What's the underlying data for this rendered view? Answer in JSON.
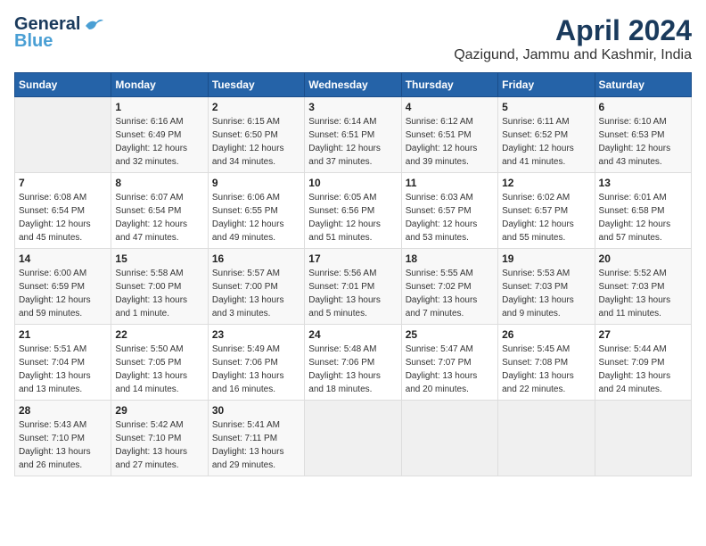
{
  "header": {
    "logo_line1": "General",
    "logo_line2": "Blue",
    "month_title": "April 2024",
    "location": "Qazigund, Jammu and Kashmir, India"
  },
  "days_of_week": [
    "Sunday",
    "Monday",
    "Tuesday",
    "Wednesday",
    "Thursday",
    "Friday",
    "Saturday"
  ],
  "weeks": [
    [
      {
        "day": "",
        "sunrise": "",
        "sunset": "",
        "daylight": ""
      },
      {
        "day": "1",
        "sunrise": "Sunrise: 6:16 AM",
        "sunset": "Sunset: 6:49 PM",
        "daylight": "Daylight: 12 hours and 32 minutes."
      },
      {
        "day": "2",
        "sunrise": "Sunrise: 6:15 AM",
        "sunset": "Sunset: 6:50 PM",
        "daylight": "Daylight: 12 hours and 34 minutes."
      },
      {
        "day": "3",
        "sunrise": "Sunrise: 6:14 AM",
        "sunset": "Sunset: 6:51 PM",
        "daylight": "Daylight: 12 hours and 37 minutes."
      },
      {
        "day": "4",
        "sunrise": "Sunrise: 6:12 AM",
        "sunset": "Sunset: 6:51 PM",
        "daylight": "Daylight: 12 hours and 39 minutes."
      },
      {
        "day": "5",
        "sunrise": "Sunrise: 6:11 AM",
        "sunset": "Sunset: 6:52 PM",
        "daylight": "Daylight: 12 hours and 41 minutes."
      },
      {
        "day": "6",
        "sunrise": "Sunrise: 6:10 AM",
        "sunset": "Sunset: 6:53 PM",
        "daylight": "Daylight: 12 hours and 43 minutes."
      }
    ],
    [
      {
        "day": "7",
        "sunrise": "Sunrise: 6:08 AM",
        "sunset": "Sunset: 6:54 PM",
        "daylight": "Daylight: 12 hours and 45 minutes."
      },
      {
        "day": "8",
        "sunrise": "Sunrise: 6:07 AM",
        "sunset": "Sunset: 6:54 PM",
        "daylight": "Daylight: 12 hours and 47 minutes."
      },
      {
        "day": "9",
        "sunrise": "Sunrise: 6:06 AM",
        "sunset": "Sunset: 6:55 PM",
        "daylight": "Daylight: 12 hours and 49 minutes."
      },
      {
        "day": "10",
        "sunrise": "Sunrise: 6:05 AM",
        "sunset": "Sunset: 6:56 PM",
        "daylight": "Daylight: 12 hours and 51 minutes."
      },
      {
        "day": "11",
        "sunrise": "Sunrise: 6:03 AM",
        "sunset": "Sunset: 6:57 PM",
        "daylight": "Daylight: 12 hours and 53 minutes."
      },
      {
        "day": "12",
        "sunrise": "Sunrise: 6:02 AM",
        "sunset": "Sunset: 6:57 PM",
        "daylight": "Daylight: 12 hours and 55 minutes."
      },
      {
        "day": "13",
        "sunrise": "Sunrise: 6:01 AM",
        "sunset": "Sunset: 6:58 PM",
        "daylight": "Daylight: 12 hours and 57 minutes."
      }
    ],
    [
      {
        "day": "14",
        "sunrise": "Sunrise: 6:00 AM",
        "sunset": "Sunset: 6:59 PM",
        "daylight": "Daylight: 12 hours and 59 minutes."
      },
      {
        "day": "15",
        "sunrise": "Sunrise: 5:58 AM",
        "sunset": "Sunset: 7:00 PM",
        "daylight": "Daylight: 13 hours and 1 minute."
      },
      {
        "day": "16",
        "sunrise": "Sunrise: 5:57 AM",
        "sunset": "Sunset: 7:00 PM",
        "daylight": "Daylight: 13 hours and 3 minutes."
      },
      {
        "day": "17",
        "sunrise": "Sunrise: 5:56 AM",
        "sunset": "Sunset: 7:01 PM",
        "daylight": "Daylight: 13 hours and 5 minutes."
      },
      {
        "day": "18",
        "sunrise": "Sunrise: 5:55 AM",
        "sunset": "Sunset: 7:02 PM",
        "daylight": "Daylight: 13 hours and 7 minutes."
      },
      {
        "day": "19",
        "sunrise": "Sunrise: 5:53 AM",
        "sunset": "Sunset: 7:03 PM",
        "daylight": "Daylight: 13 hours and 9 minutes."
      },
      {
        "day": "20",
        "sunrise": "Sunrise: 5:52 AM",
        "sunset": "Sunset: 7:03 PM",
        "daylight": "Daylight: 13 hours and 11 minutes."
      }
    ],
    [
      {
        "day": "21",
        "sunrise": "Sunrise: 5:51 AM",
        "sunset": "Sunset: 7:04 PM",
        "daylight": "Daylight: 13 hours and 13 minutes."
      },
      {
        "day": "22",
        "sunrise": "Sunrise: 5:50 AM",
        "sunset": "Sunset: 7:05 PM",
        "daylight": "Daylight: 13 hours and 14 minutes."
      },
      {
        "day": "23",
        "sunrise": "Sunrise: 5:49 AM",
        "sunset": "Sunset: 7:06 PM",
        "daylight": "Daylight: 13 hours and 16 minutes."
      },
      {
        "day": "24",
        "sunrise": "Sunrise: 5:48 AM",
        "sunset": "Sunset: 7:06 PM",
        "daylight": "Daylight: 13 hours and 18 minutes."
      },
      {
        "day": "25",
        "sunrise": "Sunrise: 5:47 AM",
        "sunset": "Sunset: 7:07 PM",
        "daylight": "Daylight: 13 hours and 20 minutes."
      },
      {
        "day": "26",
        "sunrise": "Sunrise: 5:45 AM",
        "sunset": "Sunset: 7:08 PM",
        "daylight": "Daylight: 13 hours and 22 minutes."
      },
      {
        "day": "27",
        "sunrise": "Sunrise: 5:44 AM",
        "sunset": "Sunset: 7:09 PM",
        "daylight": "Daylight: 13 hours and 24 minutes."
      }
    ],
    [
      {
        "day": "28",
        "sunrise": "Sunrise: 5:43 AM",
        "sunset": "Sunset: 7:10 PM",
        "daylight": "Daylight: 13 hours and 26 minutes."
      },
      {
        "day": "29",
        "sunrise": "Sunrise: 5:42 AM",
        "sunset": "Sunset: 7:10 PM",
        "daylight": "Daylight: 13 hours and 27 minutes."
      },
      {
        "day": "30",
        "sunrise": "Sunrise: 5:41 AM",
        "sunset": "Sunset: 7:11 PM",
        "daylight": "Daylight: 13 hours and 29 minutes."
      },
      {
        "day": "",
        "sunrise": "",
        "sunset": "",
        "daylight": ""
      },
      {
        "day": "",
        "sunrise": "",
        "sunset": "",
        "daylight": ""
      },
      {
        "day": "",
        "sunrise": "",
        "sunset": "",
        "daylight": ""
      },
      {
        "day": "",
        "sunrise": "",
        "sunset": "",
        "daylight": ""
      }
    ]
  ]
}
